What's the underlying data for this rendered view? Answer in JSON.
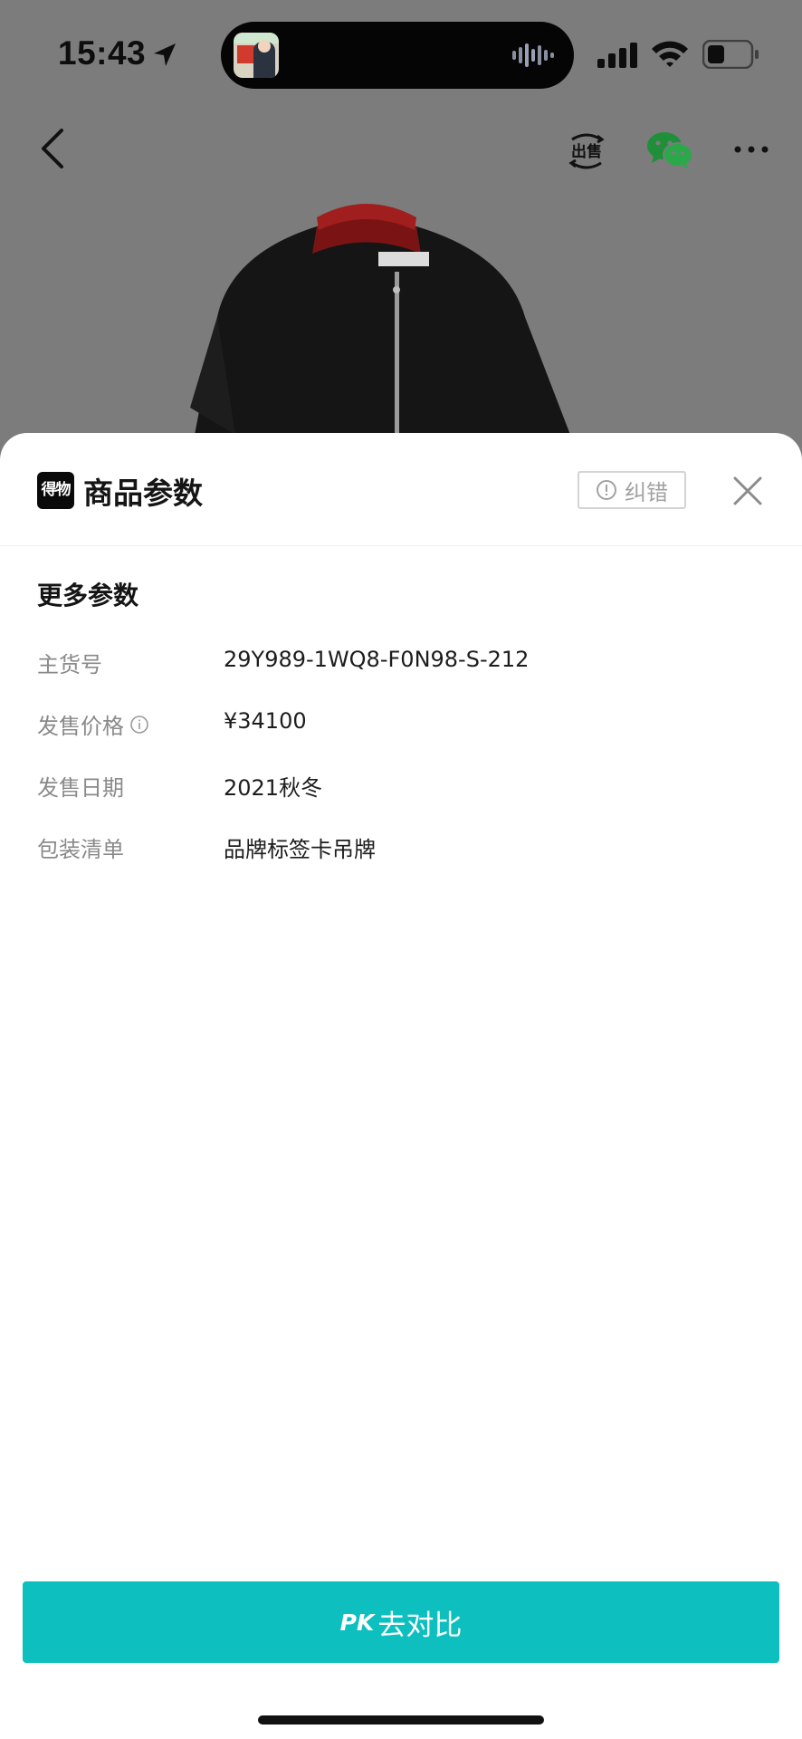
{
  "status_bar": {
    "time": "15:43"
  },
  "nav": {
    "sell_label": "出售"
  },
  "sheet": {
    "brand_logo_text": "得物",
    "title": "商品参数",
    "correct_button_label": "纠错",
    "section_title": "更多参数",
    "params": [
      {
        "label": "主货号",
        "value": "29Y989-1WQ8-F0N98-S-212"
      },
      {
        "label": "发售价格",
        "value": "¥34100"
      },
      {
        "label": "发售日期",
        "value": "2021秋冬"
      },
      {
        "label": "包装清单",
        "value": "品牌标签卡吊牌"
      }
    ],
    "pk_badge": "PK",
    "pk_label": "去对比"
  },
  "colors": {
    "accent": "#0dbfbf",
    "overlay": "#7c7c7c",
    "wechat_green": "#1f8f3a"
  },
  "icons": [
    "location-arrow-icon",
    "waveform-icon",
    "signal-icon",
    "wifi-icon",
    "battery-icon",
    "back-icon",
    "sell-icon",
    "wechat-icon",
    "more-icon",
    "info-circle-icon",
    "close-icon"
  ]
}
